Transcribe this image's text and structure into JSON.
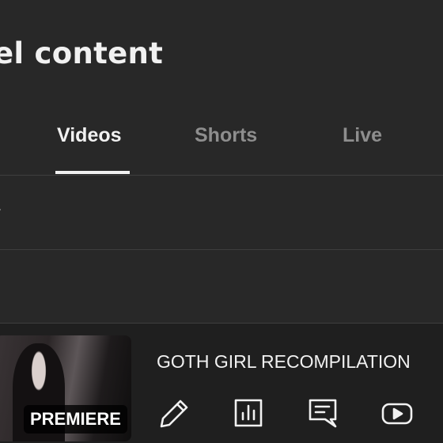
{
  "page": {
    "title": "el content"
  },
  "tabs": [
    {
      "label": "Videos",
      "active": true
    },
    {
      "label": "Shorts",
      "active": false
    },
    {
      "label": "Live",
      "active": false
    }
  ],
  "filter": {
    "placeholder": "er"
  },
  "video": {
    "title": "GOTH GIRL RECOMPILATION",
    "badge": "PREMIERE",
    "actions": [
      "pencil-icon",
      "analytics-icon",
      "comments-icon",
      "youtube-play-icon"
    ]
  }
}
